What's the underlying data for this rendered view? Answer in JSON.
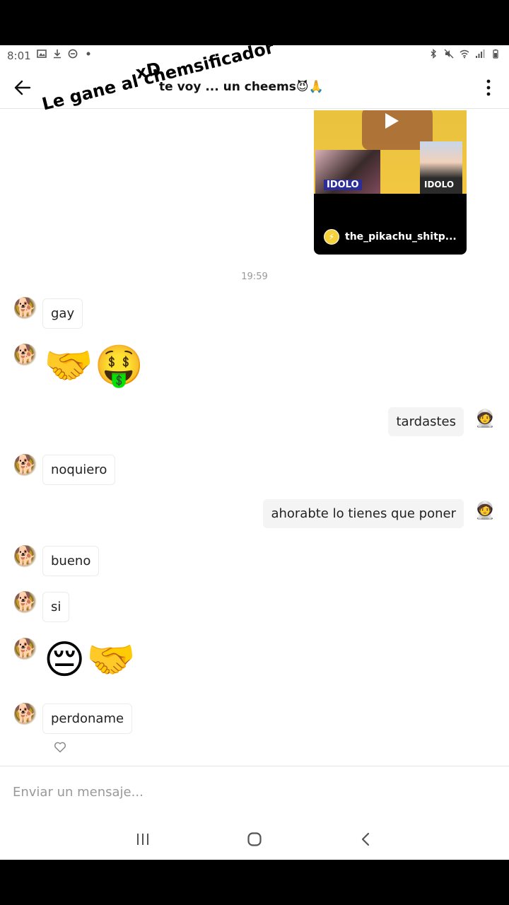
{
  "status_bar": {
    "time": "8:01",
    "left_icons": [
      "image-icon",
      "download-icon",
      "do-not-disturb-icon",
      "dot-icon"
    ],
    "right_icons": [
      "bluetooth-icon",
      "mute-icon",
      "wifi-icon",
      "signal-icon",
      "battery-icon"
    ]
  },
  "header": {
    "title": "te voy ... un cheems😈🙏",
    "back_icon": "back-arrow-icon",
    "menu_icon": "more-vertical-icon"
  },
  "overlay": {
    "xd": "xD",
    "caption": "Le gane al chemsificador"
  },
  "shared_video": {
    "label_left": "IDOLO",
    "label_right": "IDOLO",
    "author": "the_pikachu_shitp...",
    "play_icon": "play-icon"
  },
  "timestamp": "19:59",
  "messages": [
    {
      "from": "them",
      "kind": "text",
      "text": "gay"
    },
    {
      "from": "them",
      "kind": "emoji",
      "text": "🤝🤑"
    },
    {
      "from": "me",
      "kind": "text",
      "text": "tardastes"
    },
    {
      "from": "them",
      "kind": "text",
      "text": "noquiero"
    },
    {
      "from": "me",
      "kind": "text",
      "text": "ahorabte lo tienes que poner"
    },
    {
      "from": "them",
      "kind": "text",
      "text": "bueno"
    },
    {
      "from": "them",
      "kind": "text",
      "text": "si"
    },
    {
      "from": "them",
      "kind": "emoji",
      "text": "😔🤝"
    },
    {
      "from": "them",
      "kind": "text",
      "text": "perdoname"
    }
  ],
  "avatars": {
    "them": "🐕",
    "me": "🧑‍🚀"
  },
  "composer": {
    "placeholder": "Enviar un mensaje..."
  },
  "nav": [
    "recents-icon",
    "home-icon",
    "back-icon"
  ]
}
